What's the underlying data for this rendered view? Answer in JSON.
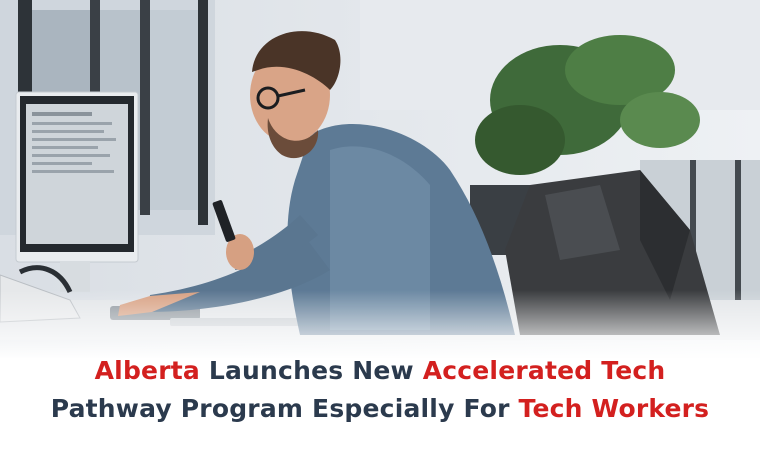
{
  "headline": {
    "line1": [
      "Alberta",
      " Launches New ",
      "Accelerated Tech"
    ],
    "line2": [
      "Pathway Program Especially For ",
      "Tech Workers"
    ]
  },
  "colors": {
    "accent": "#d3201f",
    "text": "#2b3a4d",
    "background": "#ffffff"
  },
  "photo": {
    "subject": "man with glasses working at a desktop computer holding a phone in a bright office"
  }
}
